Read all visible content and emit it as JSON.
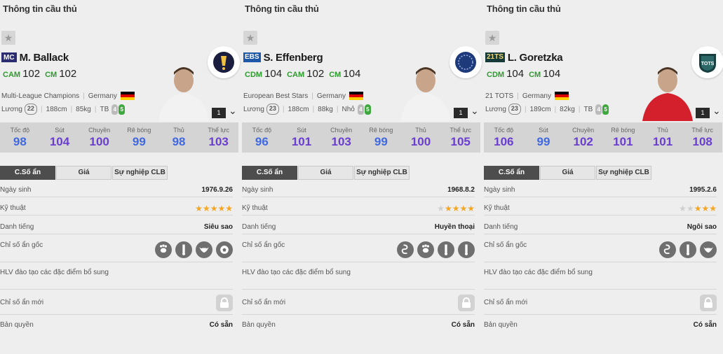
{
  "players": [
    {
      "header_title": "Thông tin cầu thủ",
      "season_badge": "MC",
      "season_class": "mc",
      "name": "M. Ballack",
      "positions": [
        {
          "pos": "CAM",
          "ovr": "102"
        },
        {
          "pos": "CM",
          "ovr": "102"
        }
      ],
      "season_full": "Multi-League Champions",
      "nationality": "Germany",
      "salary_label": "Lương",
      "salary": "22",
      "height": "188cm",
      "weight": "85kg",
      "body_type": "TB",
      "weak_foot": "4",
      "strong_foot": "5",
      "level": "1",
      "club_icon": "premier-league-icon",
      "stats": [
        {
          "label": "Tốc độ",
          "value": "98",
          "color": "blue"
        },
        {
          "label": "Sút",
          "value": "104",
          "color": "purple"
        },
        {
          "label": "Chuyền",
          "value": "100",
          "color": "purple"
        },
        {
          "label": "Rê bóng",
          "value": "99",
          "color": "blue"
        },
        {
          "label": "Thủ",
          "value": "98",
          "color": "blue"
        },
        {
          "label": "Thể lực",
          "value": "103",
          "color": "purple"
        }
      ],
      "tabs": [
        "C.Số ẩn",
        "Giá",
        "Sự nghiệp CLB"
      ],
      "rows": {
        "birth_label": "Ngày sinh",
        "birth": "1976.9.26",
        "skill_label": "Kỹ thuật",
        "skill_stars": 5,
        "rep_label": "Danh tiếng",
        "rep": "Siêu sao",
        "traits_label": "Chỉ số ẩn gốc",
        "traits": [
          "paw-icon",
          "tower-icon",
          "bull-icon",
          "ball-icon"
        ],
        "coach_label": "HLV đào tạo các đặc điểm bổ sung",
        "new_label": "Chỉ số ẩn mới",
        "rights_label": "Bản quyền",
        "rights": "Có sẵn"
      }
    },
    {
      "header_title": "Thông tin cầu thủ",
      "season_badge": "EBS",
      "season_class": "ebs",
      "name": "S. Effenberg",
      "positions": [
        {
          "pos": "CDM",
          "ovr": "104"
        },
        {
          "pos": "CAM",
          "ovr": "102"
        },
        {
          "pos": "CM",
          "ovr": "104"
        }
      ],
      "season_full": "European Best Stars",
      "nationality": "Germany",
      "salary_label": "Lương",
      "salary": "23",
      "height": "188cm",
      "weight": "88kg",
      "body_type": "Nhỏ",
      "weak_foot": "4",
      "strong_foot": "5",
      "level": "1",
      "club_icon": "globe-icon",
      "stats": [
        {
          "label": "Tốc độ",
          "value": "96",
          "color": "blue"
        },
        {
          "label": "Sút",
          "value": "101",
          "color": "purple"
        },
        {
          "label": "Chuyền",
          "value": "103",
          "color": "purple"
        },
        {
          "label": "Rê bóng",
          "value": "99",
          "color": "blue"
        },
        {
          "label": "Thủ",
          "value": "100",
          "color": "purple"
        },
        {
          "label": "Thể lực",
          "value": "105",
          "color": "purple"
        }
      ],
      "tabs": [
        "C.Số ẩn",
        "Giá",
        "Sự nghiệp CLB"
      ],
      "rows": {
        "birth_label": "Ngày sinh",
        "birth": "1968.8.2",
        "skill_label": "Kỹ thuật",
        "skill_stars": 4,
        "rep_label": "Danh tiếng",
        "rep": "Huyền thoại",
        "traits_label": "Chỉ số ẩn gốc",
        "traits": [
          "snake-icon",
          "paw-icon",
          "tower-icon",
          "tower-icon"
        ],
        "coach_label": "HLV đào tạo các đặc điểm bổ sung",
        "new_label": "Chỉ số ẩn mới",
        "rights_label": "Bản quyền",
        "rights": "Có sẵn"
      }
    },
    {
      "header_title": "Thông tin cầu thủ",
      "season_badge": "21TS",
      "season_class": "tots",
      "name": "L. Goretzka",
      "positions": [
        {
          "pos": "CDM",
          "ovr": "104"
        },
        {
          "pos": "CM",
          "ovr": "104"
        }
      ],
      "season_full": "21 TOTS",
      "nationality": "Germany",
      "salary_label": "Lương",
      "salary": "23",
      "height": "189cm",
      "weight": "82kg",
      "body_type": "TB",
      "weak_foot": "4",
      "strong_foot": "5",
      "level": "1",
      "club_icon": "tots-badge-icon",
      "club_text": "TOTS",
      "stats": [
        {
          "label": "Tốc độ",
          "value": "106",
          "color": "purple"
        },
        {
          "label": "Sút",
          "value": "99",
          "color": "blue"
        },
        {
          "label": "Chuyền",
          "value": "102",
          "color": "purple"
        },
        {
          "label": "Rê bóng",
          "value": "101",
          "color": "purple"
        },
        {
          "label": "Thủ",
          "value": "101",
          "color": "purple"
        },
        {
          "label": "Thể lực",
          "value": "108",
          "color": "purple"
        }
      ],
      "tabs": [
        "C.Số ẩn",
        "Giá",
        "Sự nghiệp CLB"
      ],
      "rows": {
        "birth_label": "Ngày sinh",
        "birth": "1995.2.6",
        "skill_label": "Kỹ thuật",
        "skill_stars": 3,
        "rep_label": "Danh tiếng",
        "rep": "Ngôi sao",
        "traits_label": "Chỉ số ẩn gốc",
        "traits": [
          "snake-icon",
          "tower-icon",
          "bull-icon"
        ],
        "coach_label": "HLV đào tạo các đặc điểm bổ sung",
        "new_label": "Chỉ số ẩn mới",
        "rights_label": "Bản quyền",
        "rights": "Có sẵn"
      }
    }
  ],
  "colors": {
    "position": "#2e9b2e",
    "stat_blue": "#4169e1",
    "stat_purple": "#6a3fd0",
    "star_on": "#f5a623"
  }
}
